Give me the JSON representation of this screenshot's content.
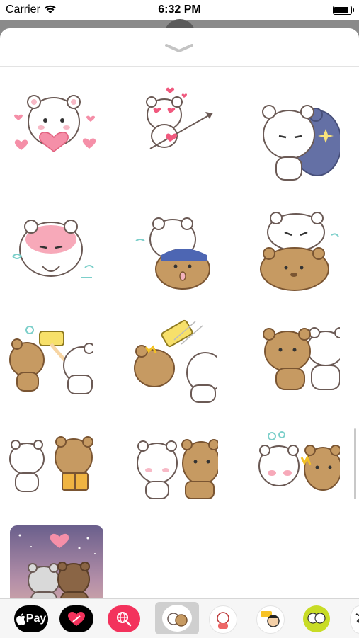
{
  "status_bar": {
    "carrier": "Carrier",
    "time": "6:32 PM"
  },
  "sheet": {
    "grabber_icon": "chevron-down-icon",
    "stickers": [
      {
        "name": "white-bear-hearts"
      },
      {
        "name": "bear-cupid-arrow"
      },
      {
        "name": "white-bear-shadow"
      },
      {
        "name": "white-bear-blushing"
      },
      {
        "name": "white-bear-hug-brown"
      },
      {
        "name": "white-bear-lying-brown"
      },
      {
        "name": "brown-bear-hammer"
      },
      {
        "name": "hammer-hit"
      },
      {
        "name": "bears-cuddle"
      },
      {
        "name": "bears-book"
      },
      {
        "name": "bears-kiss"
      },
      {
        "name": "bears-angry"
      }
    ],
    "featured_sticker": "bears-stargazing"
  },
  "app_drawer": {
    "apple_pay_label": "Pay",
    "apps": [
      "apple-pay",
      "digital-touch",
      "image-search",
      "milk-mocha-stickers",
      "sticker-app-2",
      "sticker-app-3",
      "sticker-app-4",
      "sticker-app-5"
    ]
  },
  "colors": {
    "accent_pink": "#f3325c",
    "white": "#ffffff",
    "black": "#000000"
  }
}
